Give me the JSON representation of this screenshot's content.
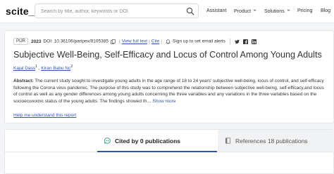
{
  "header": {
    "logo": "scite_",
    "search_placeholder": "Search by title, author, keywords or DOI",
    "nav": {
      "assistant": "Assistant",
      "product": "Product",
      "solutions": "Solutions",
      "pricing": "Pricing",
      "blog": "Blog"
    }
  },
  "paper": {
    "journal": "PIJR",
    "year": "2023",
    "doi": "DOI: 10.36106/paripex/9105385",
    "view_full_text": "View full text",
    "cite": "Cite",
    "alerts": "Sign up to set email alerts",
    "title": "Subjective Well-Being, Self-Efficacy and Locus of Control Among Young Adults",
    "authors": [
      {
        "name": "Kajal Dass",
        "sup": "1"
      },
      {
        "name": "Kiran Babu Nc",
        "sup": "2"
      }
    ],
    "abstract_label": "Abstract:",
    "abstract_text": " The current study sought to investigate young adults in the age range of 18 to 24 years' subjective well-being, locus of control, and self-efficacy following the Corona virus pandemic. The purpose of this study was to comprehend the relationship between subjective well-being, self-efficacy,and locus of control as well as any gender differences among young adults concerning the three variables and any variations in the three variables based on the socioeconomic status of the young adults. The findings showed th… ",
    "show_more": "Show more",
    "help_link": "Help me understand this report"
  },
  "tabs": {
    "cited_by": "Cited by 0 publications",
    "references": "References 18 publications"
  },
  "colors": {
    "link": "#2f55b0",
    "accent_green": "#2e9f6b"
  }
}
